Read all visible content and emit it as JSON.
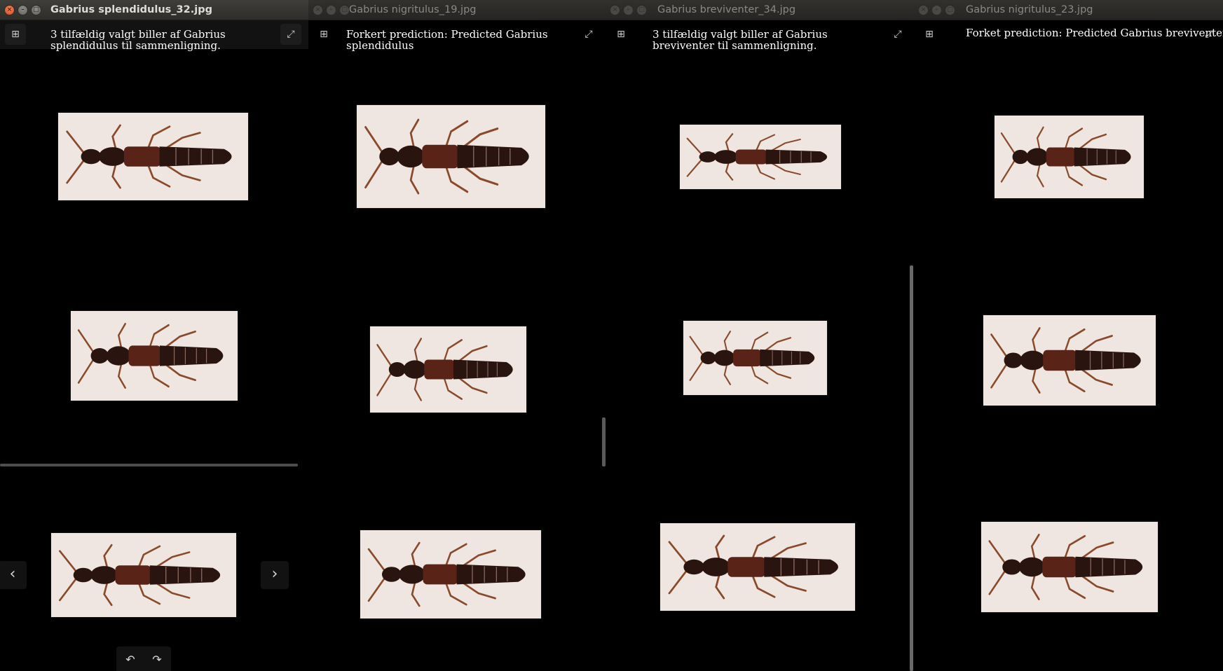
{
  "windows": [
    {
      "title": "Gabrius splendidulus_32.jpg",
      "caption": "3 tilfældig valgt biller af Gabrius splendidulus til sammenligning.",
      "state": "active",
      "add_icon": "plus-square-icon",
      "fullscreen_icon": "expand-icon"
    },
    {
      "title": "Gabrius nigritulus_19.jpg",
      "caption": "Forkert prediction: Predicted Gabrius splendidulus",
      "state": "inactive",
      "add_icon": "plus-square-icon",
      "fullscreen_icon": "expand-icon"
    },
    {
      "title": "Gabrius breviventer_34.jpg",
      "caption": "3 tilfældig valgt biller af Gabrius breviventer til sammenligning.",
      "state": "inactive",
      "add_icon": "plus-square-icon",
      "fullscreen_icon": "expand-icon"
    },
    {
      "title": "Gabrius nigritulus_23.jpg",
      "caption": "Forket prediction: Predicted Gabrius breviventer",
      "state": "inactive",
      "add_icon": "plus-square-icon",
      "fullscreen_icon": "expand-icon"
    }
  ],
  "window_buttons": {
    "close": "×",
    "minimize": "–",
    "maximize": "□"
  },
  "toolbar_glyphs": {
    "add": "⊞",
    "fullscreen": "⤢"
  },
  "nav": {
    "prev": "‹",
    "next": "›",
    "rotate_left": "↶",
    "rotate_right": "↷"
  },
  "colors": {
    "background": "#000000",
    "titlebar_active": "#3c3b37",
    "close_button": "#e9643b",
    "specimen_card": "#efe6e1",
    "beetle_dark": "#2a1410",
    "beetle_body": "#5a2317",
    "beetle_legs": "#8a4a2a"
  }
}
